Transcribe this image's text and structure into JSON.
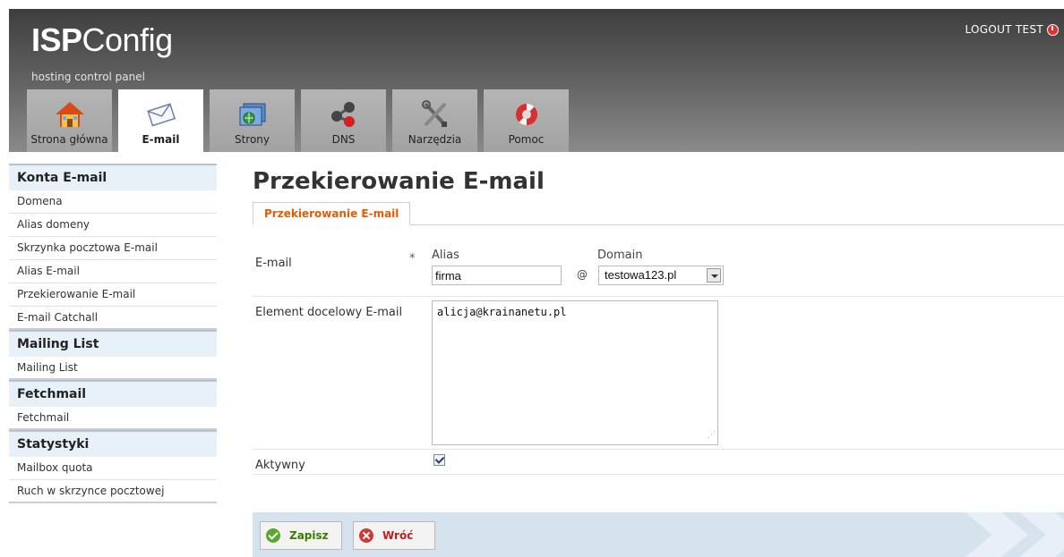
{
  "header": {
    "brand_bold": "ISP",
    "brand_light": "Config",
    "tagline": "hosting control panel",
    "logout_label": "LOGOUT TEST"
  },
  "tabs": [
    {
      "label": "Strona główna",
      "icon": "home-icon",
      "active": false
    },
    {
      "label": "E-mail",
      "icon": "envelope-icon",
      "active": true
    },
    {
      "label": "Strony",
      "icon": "globe-icon",
      "active": false
    },
    {
      "label": "DNS",
      "icon": "network-icon",
      "active": false
    },
    {
      "label": "Narzędzia",
      "icon": "tools-icon",
      "active": false
    },
    {
      "label": "Pomoc",
      "icon": "lifebuoy-icon",
      "active": false
    }
  ],
  "sidebar": {
    "groups": [
      {
        "title": "Konta E-mail",
        "items": [
          "Domena",
          "Alias domeny",
          "Skrzynka pocztowa E-mail",
          "Alias E-mail",
          "Przekierowanie E-mail",
          "E-mail Catchall"
        ]
      },
      {
        "title": "Mailing List",
        "items": [
          "Mailing List"
        ]
      },
      {
        "title": "Fetchmail",
        "items": [
          "Fetchmail"
        ]
      },
      {
        "title": "Statystyki",
        "items": [
          "Mailbox quota",
          "Ruch w skrzynce pocztowej"
        ]
      }
    ]
  },
  "main": {
    "title": "Przekierowanie E-mail",
    "subtab": "Przekierowanie E-mail",
    "form": {
      "email_label": "E-mail",
      "required_mark": "*",
      "alias_label": "Alias",
      "alias_value": "firma",
      "at_sign": "@",
      "domain_label": "Domain",
      "domain_value": "testowa123.pl",
      "dest_label": "Element docelowy E-mail",
      "dest_value": "alicja@krainanetu.pl",
      "active_label": "Aktywny",
      "active_checked": true
    },
    "buttons": {
      "save_label": "Zapisz",
      "back_label": "Wróć"
    }
  },
  "colors": {
    "accent_orange": "#e45b00",
    "sidebar_head_bg": "#e8f0f8",
    "buttonbar_bg": "#d6e3ef"
  }
}
